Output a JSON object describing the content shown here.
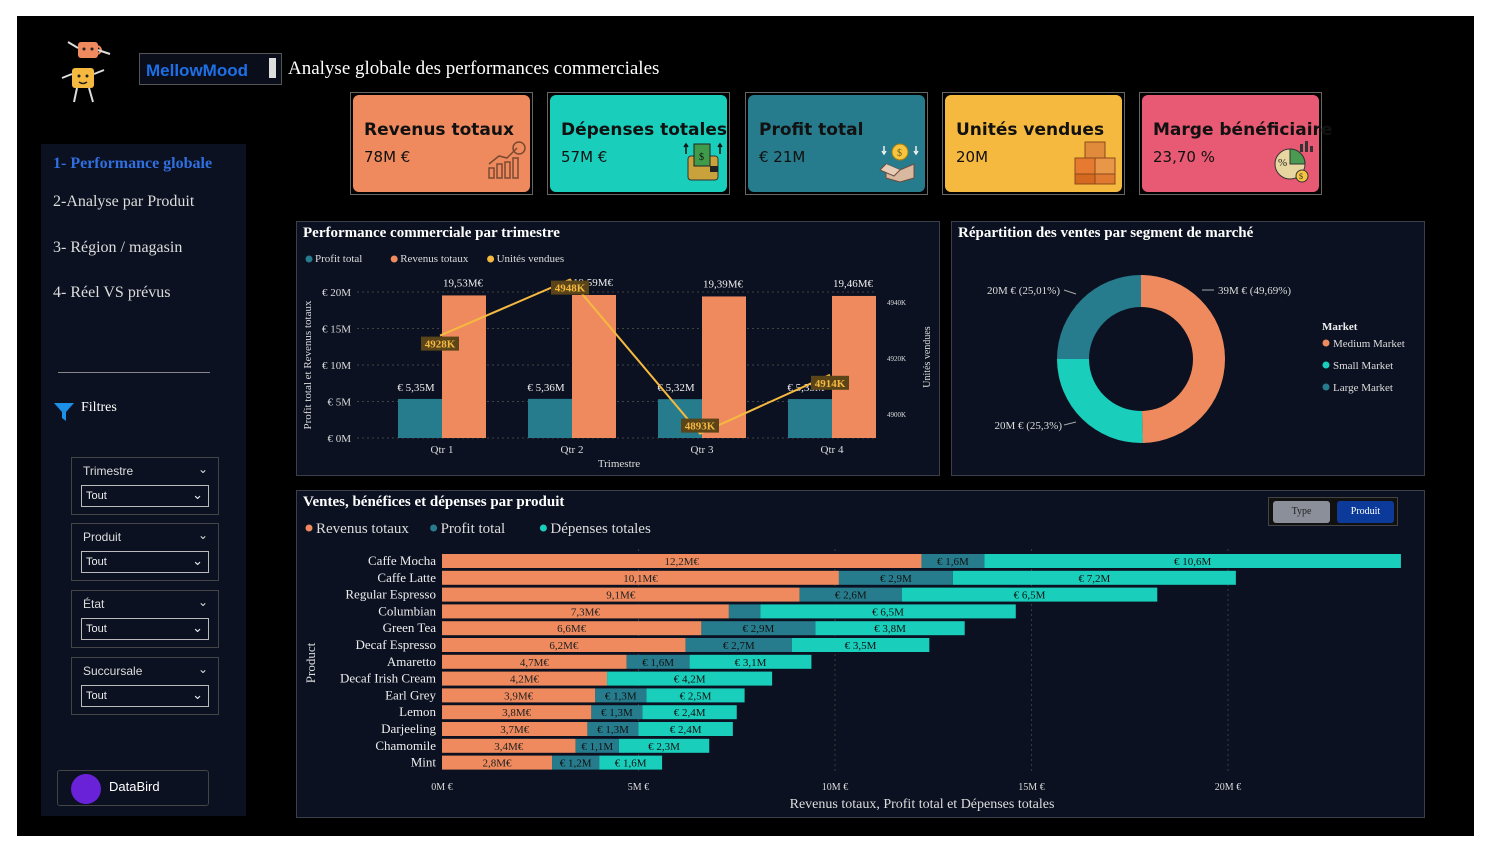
{
  "brand": "MellowMood",
  "page_title": "Analyse globale des performances commerciales",
  "nav": [
    {
      "label": "1- Performance globale",
      "active": true
    },
    {
      "label": "2-Analyse par Produit",
      "active": false
    },
    {
      "label": "3- Région / magasin",
      "active": false
    },
    {
      "label": "4- Réel VS prévus",
      "active": false
    }
  ],
  "filters_title": "Filtres",
  "slicers": [
    {
      "label": "Trimestre",
      "value": "Tout"
    },
    {
      "label": "Produit",
      "value": "Tout"
    },
    {
      "label": "État",
      "value": "Tout"
    },
    {
      "label": "Succursale",
      "value": "Tout"
    }
  ],
  "databird_label": "DataBird",
  "kpis": [
    {
      "title": "Revenus totaux",
      "value": "78M €",
      "color": "#EE8A5E",
      "icon": "growth-chart-icon"
    },
    {
      "title": "Dépenses totales",
      "value": "57M €",
      "color": "#19CEBB",
      "icon": "wallet-cash-icon"
    },
    {
      "title": "Profit total",
      "value": "€ 21M",
      "color": "#267C8C",
      "icon": "coin-box-icon"
    },
    {
      "title": "Unités vendues",
      "value": "20M",
      "color": "#F6B940",
      "icon": "boxes-icon"
    },
    {
      "title": "Marge bénéficiaire",
      "value": "23,70 %",
      "color": "#E85A73",
      "icon": "percent-pie-icon"
    }
  ],
  "colors": {
    "revenue": "#EE8A5E",
    "profit": "#267C8C",
    "expenses": "#19CEBB",
    "units": "#F6B940"
  },
  "chart_data": [
    {
      "type": "bar",
      "title": "Performance commerciale par trimestre",
      "xlabel": "Trimestre",
      "ylabel": "Profit total et Revenus totaux",
      "y2label": "Unités vendues",
      "legend": [
        "Profit total",
        "Revenus totaux",
        "Unités vendues"
      ],
      "legend_position": "top-left",
      "categories": [
        "Qtr 1",
        "Qtr 2",
        "Qtr 3",
        "Qtr 4"
      ],
      "y_ticks": [
        "€ 0M",
        "€ 5M",
        "€ 10M",
        "€ 15M",
        "€ 20M"
      ],
      "y2_ticks": [
        "4900K",
        "4920K",
        "4940K"
      ],
      "ylim": [
        0,
        20
      ],
      "y2lim": [
        4900,
        4940
      ],
      "series": [
        {
          "name": "Profit total",
          "values": [
            5.35,
            5.36,
            5.32,
            5.33
          ],
          "labels": [
            "€ 5,35M",
            "€ 5,36M",
            "€ 5,32M",
            "€ 5,33M"
          ]
        },
        {
          "name": "Revenus totaux",
          "values": [
            19.53,
            19.59,
            19.39,
            19.46
          ],
          "labels": [
            "19,53M€",
            "19,59M€",
            "19,39M€",
            "19,46M€"
          ]
        },
        {
          "name": "Unités vendues",
          "type": "line",
          "values": [
            4928,
            4948,
            4893,
            4914
          ],
          "labels": [
            "4928K",
            "4948K",
            "4893K",
            "4914K"
          ]
        }
      ],
      "grid": true
    },
    {
      "type": "pie",
      "title": "Répartition des ventes par segment de marché",
      "legend_title": "Market",
      "legend_position": "right",
      "series": [
        {
          "name": "Medium Market",
          "value": 49.69,
          "label": "39M € (49,69%)"
        },
        {
          "name": "Small Market",
          "value": 25.3,
          "label": "20M € (25,3%)"
        },
        {
          "name": "Large Market",
          "value": 25.01,
          "label": "20M € (25,01%)"
        }
      ]
    },
    {
      "type": "bar",
      "orientation": "horizontal",
      "stacked": true,
      "title": "Ventes, bénéfices et dépenses par produit",
      "xlabel": "Revenus totaux, Profit total et Dépenses totales",
      "ylabel": "Product",
      "legend": [
        "Revenus totaux",
        "Profit total",
        "Dépenses totales"
      ],
      "legend_position": "top-left",
      "x_ticks": [
        "0M €",
        "5M €",
        "10M €",
        "15M €",
        "20M €"
      ],
      "xlim": [
        0,
        25
      ],
      "categories": [
        "Caffe Mocha",
        "Caffe Latte",
        "Regular Espresso",
        "Columbian",
        "Green Tea",
        "Decaf Espresso",
        "Amaretto",
        "Decaf Irish Cream",
        "Earl Grey",
        "Lemon",
        "Darjeeling",
        "Chamomile",
        "Mint"
      ],
      "series": [
        {
          "name": "Revenus totaux",
          "values": [
            12.2,
            10.1,
            9.1,
            7.3,
            6.6,
            6.2,
            4.7,
            4.2,
            3.9,
            3.8,
            3.7,
            3.4,
            2.8
          ],
          "labels": [
            "12,2M€",
            "10,1M€",
            "9,1M€",
            "7,3M€",
            "6,6M€",
            "6,2M€",
            "4,7M€",
            "4,2M€",
            "3,9M€",
            "3,8M€",
            "3,7M€",
            "3,4M€",
            "2,8M€"
          ]
        },
        {
          "name": "Profit total",
          "values": [
            1.6,
            2.9,
            2.6,
            0.8,
            2.9,
            2.7,
            1.6,
            0,
            1.3,
            1.3,
            1.3,
            1.1,
            1.2
          ],
          "labels": [
            "€ 1,6M",
            "€ 2,9M",
            "€ 2,6M",
            "",
            "€ 2,9M",
            "€ 2,7M",
            "€ 1,6M",
            "",
            "€ 1,3M",
            "€ 1,3M",
            "€ 1,3M",
            "€ 1,1M",
            "€ 1,2M"
          ]
        },
        {
          "name": "Dépenses totales",
          "values": [
            10.6,
            7.2,
            6.5,
            6.5,
            3.8,
            3.5,
            3.1,
            4.2,
            2.5,
            2.4,
            2.4,
            2.3,
            1.6
          ],
          "labels": [
            "€ 10,6M",
            "€ 7,2M",
            "€ 6,5M",
            "€ 6,5M",
            "€ 3,8M",
            "€ 3,5M",
            "€ 3,1M",
            "€ 4,2M",
            "€ 2,5M",
            "€ 2,4M",
            "€ 2,4M",
            "€ 2,3M",
            "€ 1,6M"
          ]
        }
      ]
    }
  ],
  "toggle": {
    "options": [
      "Type",
      "Produit"
    ],
    "active": "Produit"
  }
}
